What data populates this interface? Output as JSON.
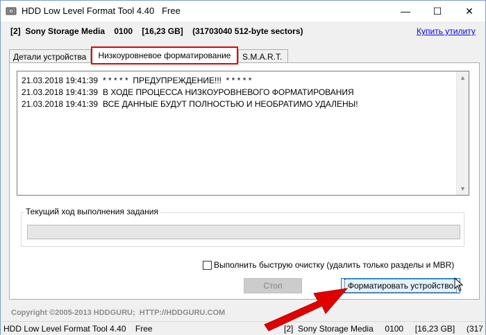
{
  "window": {
    "title": "HDD Low Level Format Tool 4.40",
    "title_suffix": "Free",
    "controls": {
      "minimize": "—",
      "maximize": "☐",
      "close": "✕"
    }
  },
  "device": {
    "summary": "[2]  Sony Storage Media    0100    [16,23 GB]    (31703040 512-byte sectors)"
  },
  "buy_link": "Купить утилиту",
  "tabs": [
    {
      "label": "Детали устройства"
    },
    {
      "label": "Низкоуровневое форматирование",
      "selected": true
    },
    {
      "label": "S.M.A.R.T."
    }
  ],
  "log": [
    {
      "time": "21.03.2018 19:41:39",
      "message": "* * * * *  ПРЕДУПРЕЖДЕНИЕ!!!  * * * * *"
    },
    {
      "time": "21.03.2018 19:41:39",
      "message": "В ХОДЕ ПРОЦЕССА НИЗКОУРОВНЕВОГО ФОРМАТИРОВАНИЯ"
    },
    {
      "time": "21.03.2018 19:41:39",
      "message": "ВСЕ ДАННЫЕ БУДУТ ПОЛНОСТЬЮ И НЕОБРАТИМО УДАЛЕНЫ!"
    }
  ],
  "progress": {
    "label": "Текущий ход выполнения задания",
    "value_percent": 0
  },
  "quick_wipe": {
    "label": "Выполнить быструю очистку (удалить только разделы и MBR)",
    "checked": false
  },
  "buttons": {
    "stop": "Стоп",
    "format": "Форматировать устройство"
  },
  "copyright": "Copyright ©2005-2013 HDDGURU;  HTTP://HDDGURU.COM",
  "statusbar": {
    "left": "HDD Low Level Format Tool 4.40    Free",
    "right": "[2]  Sony Storage Media     0100     [16,23 GB]     (317"
  },
  "colors": {
    "highlight_red": "#e00000",
    "accent_blue": "#0078d7",
    "link_blue": "#0000ee"
  }
}
